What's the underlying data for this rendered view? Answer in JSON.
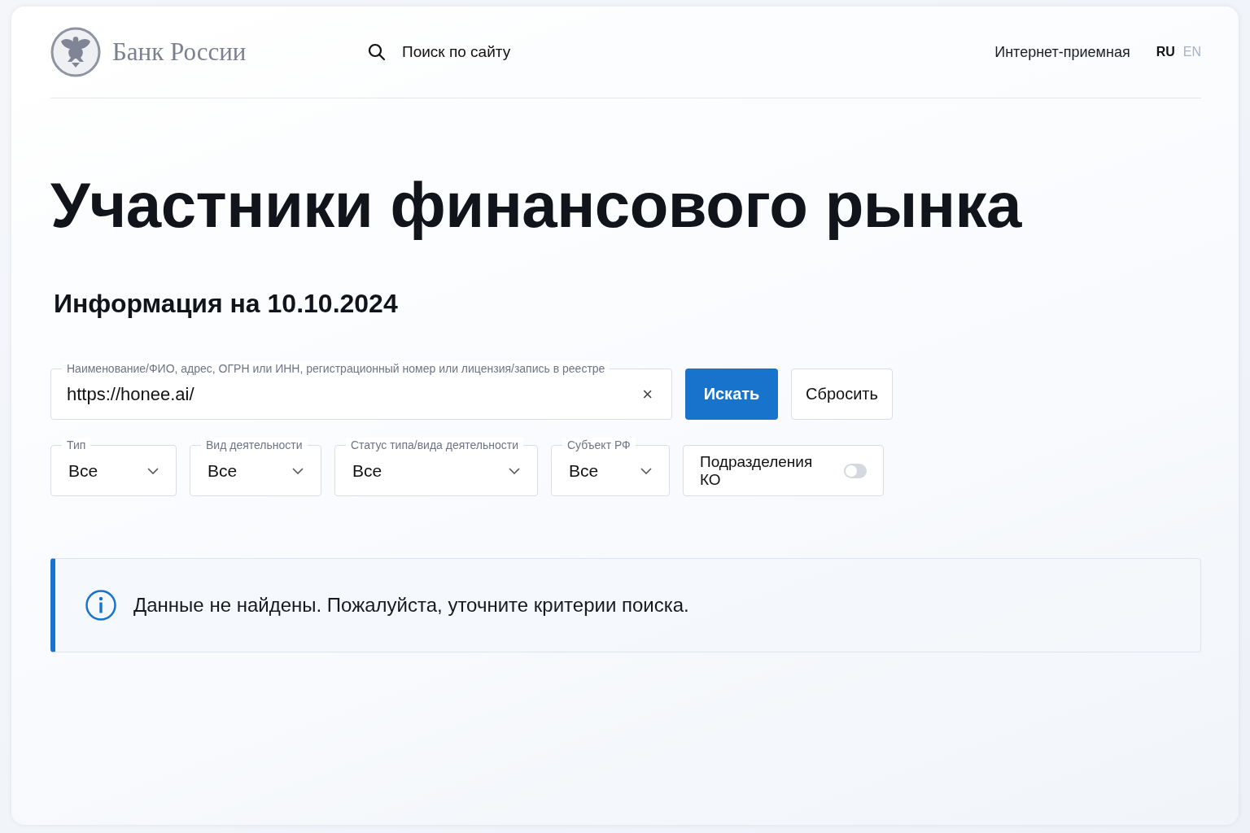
{
  "header": {
    "logo_text": "Банк России",
    "search_label": "Поиск по сайту",
    "link": "Интернет-приемная",
    "languages": [
      {
        "label": "RU",
        "selected": true
      },
      {
        "label": "EN",
        "selected": false
      }
    ]
  },
  "title": "Участники финансового рынка",
  "subtitle": "Информация на 10.10.2024",
  "search": {
    "label": "Наименование/ФИО, адрес, ОГРН или ИНН, регистрационный номер или лицензия/запись в реестре",
    "value": "https://honee.ai/",
    "clear": "×"
  },
  "buttons": [
    {
      "label": "Искать",
      "kind": "primary"
    },
    {
      "label": "Сбросить",
      "kind": "secondary"
    }
  ],
  "filters": [
    {
      "kind": "select",
      "label": "Тип",
      "value": "Все"
    },
    {
      "kind": "select",
      "label": "Вид деятельности",
      "value": "Все"
    },
    {
      "kind": "select",
      "label": "Статус типа/вида деятельности",
      "value": "Все"
    },
    {
      "kind": "select",
      "label": "Субъект РФ",
      "value": "Все"
    },
    {
      "kind": "toggle",
      "label": "Подразделения КО",
      "on": false
    }
  ],
  "alert": {
    "message": "Данные не найдены. Пожалуйста, уточните критерии поиска."
  }
}
